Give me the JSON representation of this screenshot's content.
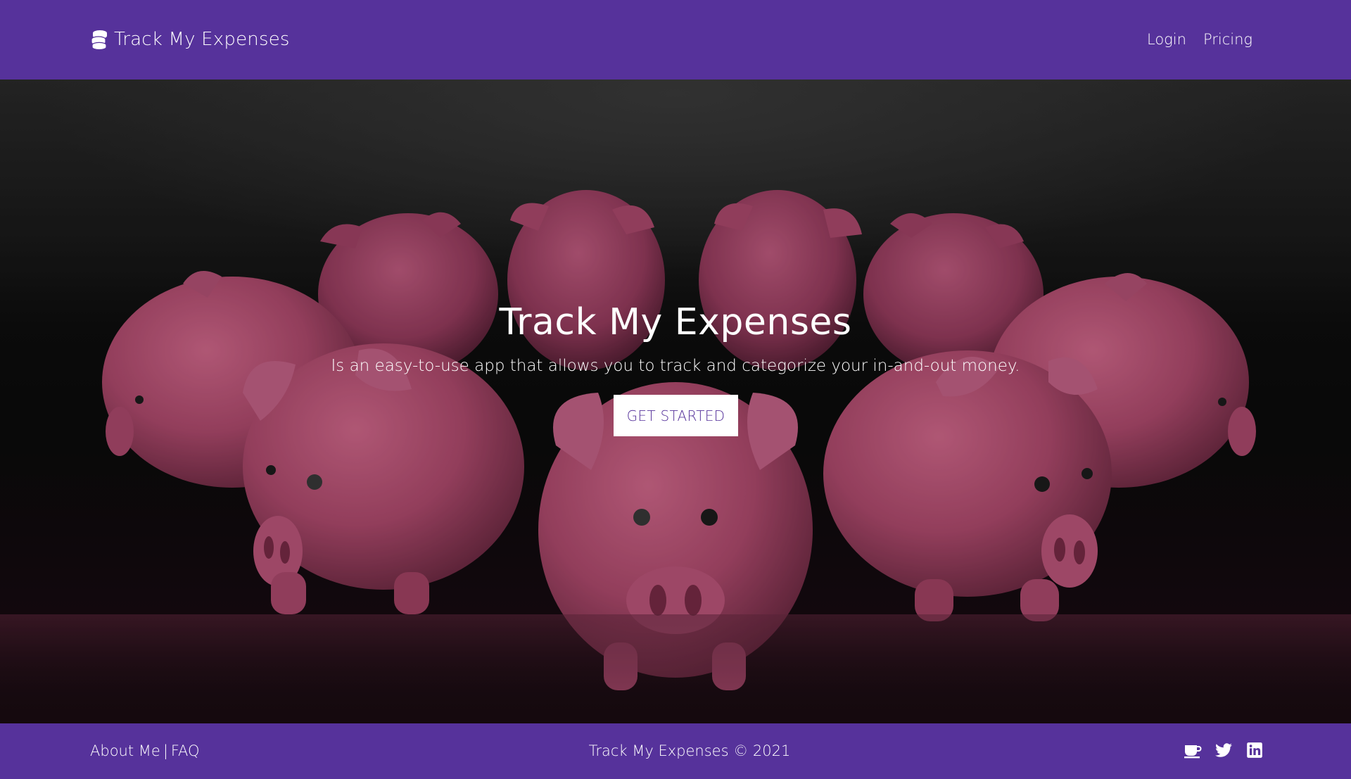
{
  "header": {
    "brand_label": "Track My Expenses",
    "brand_icon": "coins-icon",
    "nav": {
      "login_label": "Login",
      "pricing_label": "Pricing"
    }
  },
  "hero": {
    "title": "Track My Expenses",
    "subtitle": "Is an easy-to-use app that allows you to track and categorize your in-and-out money.",
    "cta_label": "GET STARTED",
    "background_image": "piggy-banks-photo"
  },
  "footer": {
    "about_label": "About Me",
    "separator": "|",
    "faq_label": "FAQ",
    "copyright": "Track My Expenses © 2021",
    "social": {
      "coffee_icon": "coffee-icon",
      "twitter_icon": "twitter-icon",
      "linkedin_icon": "linkedin-icon"
    }
  },
  "colors": {
    "brand_purple": "#56329b",
    "white": "#ffffff",
    "pig_pink": "#b84f73"
  }
}
